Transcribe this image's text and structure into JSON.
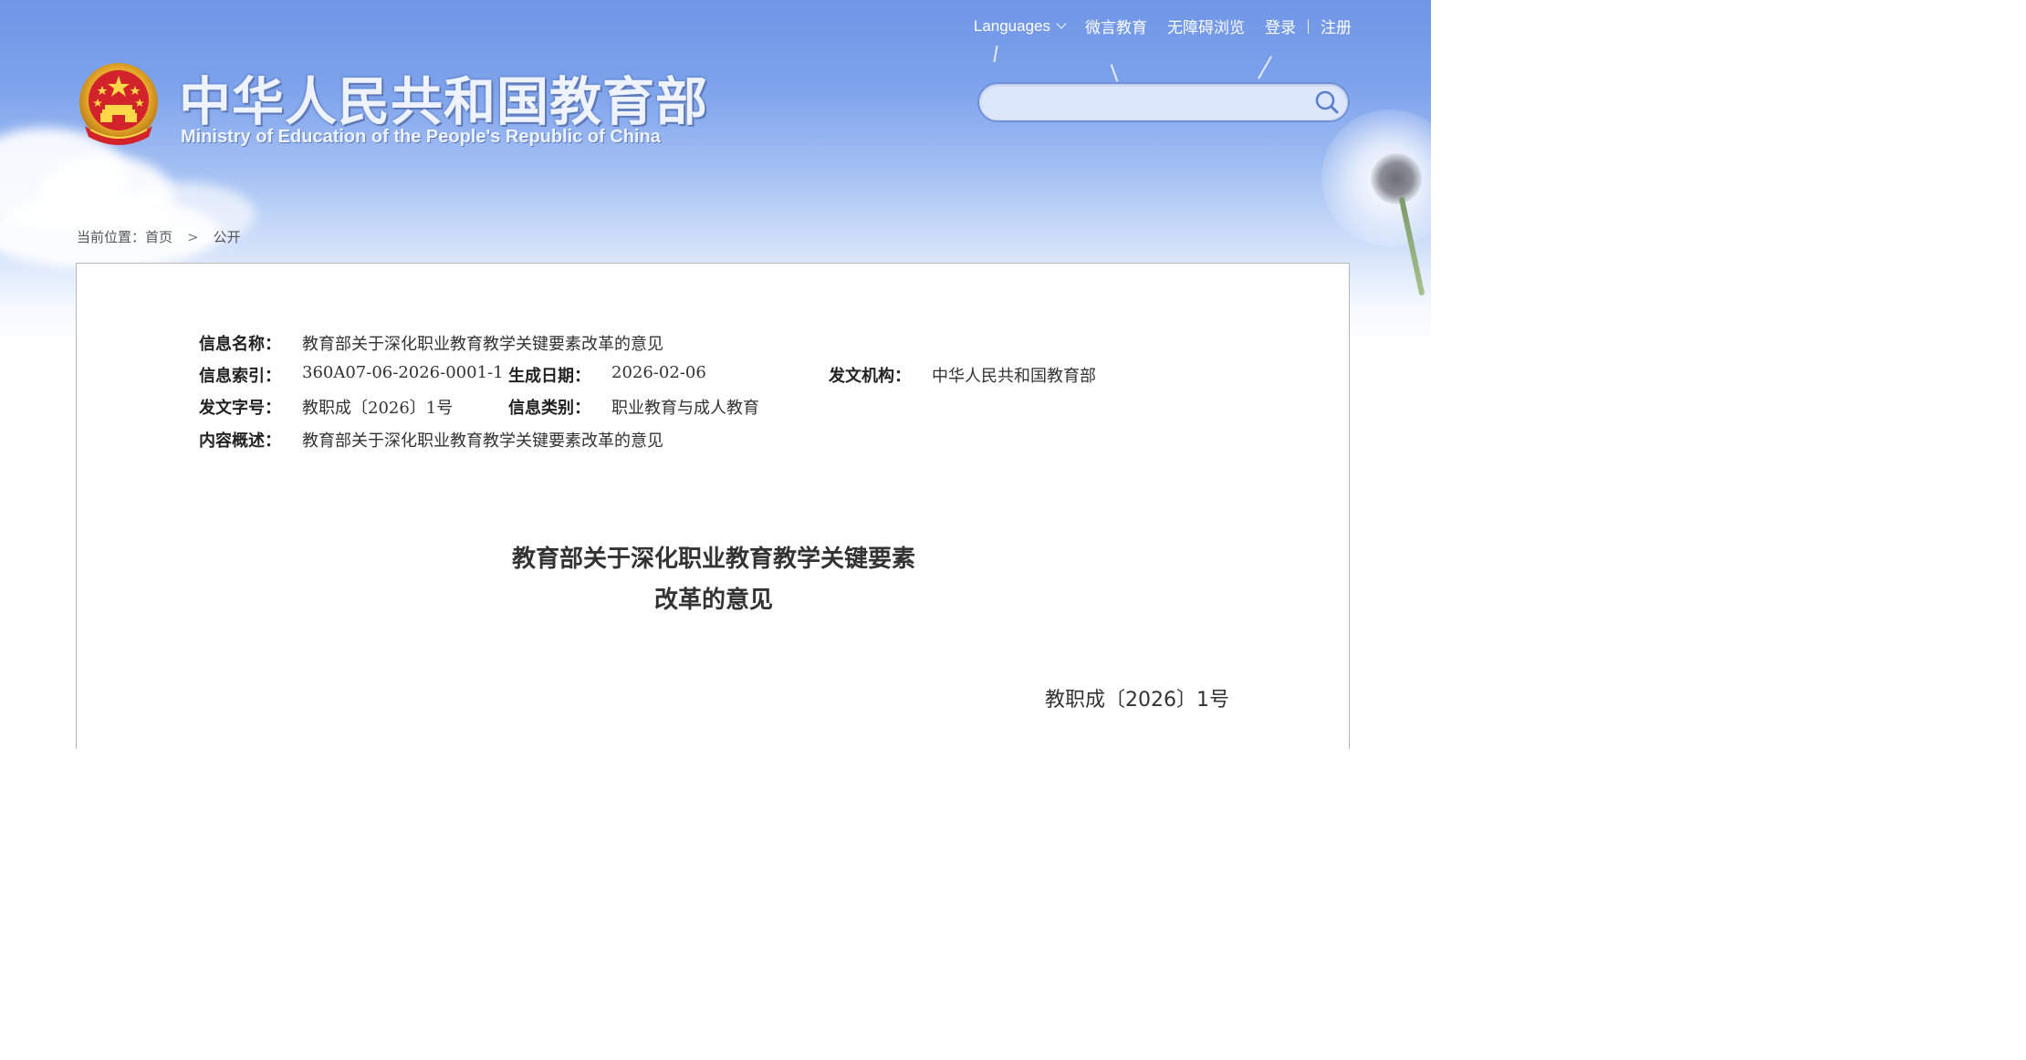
{
  "topnav": {
    "languages": "Languages",
    "weiyan": "微言教育",
    "accessibility": "无障碍浏览",
    "login": "登录",
    "register": "注册"
  },
  "header": {
    "title": "中华人民共和国教育部",
    "subtitle": "Ministry of Education of the People's Republic of China"
  },
  "search": {
    "placeholder": ""
  },
  "breadcrumb": {
    "prefix": "当前位置：",
    "home": "首页",
    "separator": ">",
    "current": "公开"
  },
  "meta": {
    "name_label": "信息名称：",
    "name_value": "教育部关于深化职业教育教学关键要素改革的意见",
    "index_label": "信息索引：",
    "index_value": "360A07-06-2026-0001-1",
    "date_label": "生成日期：",
    "date_value": "2026-02-06",
    "issuer_label": "发文机构：",
    "issuer_value": "中华人民共和国教育部",
    "docno_label": "发文字号：",
    "docno_value": "教职成〔2026〕1号",
    "category_label": "信息类别：",
    "category_value": "职业教育与成人教育",
    "summary_label": "内容概述：",
    "summary_value": "教育部关于深化职业教育教学关键要素改革的意见"
  },
  "document": {
    "title_line1": "教育部关于深化职业教育教学关键要素",
    "title_line2": "改革的意见",
    "number": "教职成〔2026〕1号"
  },
  "colors": {
    "sky_top": "#6f95e6",
    "panel_border": "#b7b7b7",
    "text": "#333333"
  }
}
